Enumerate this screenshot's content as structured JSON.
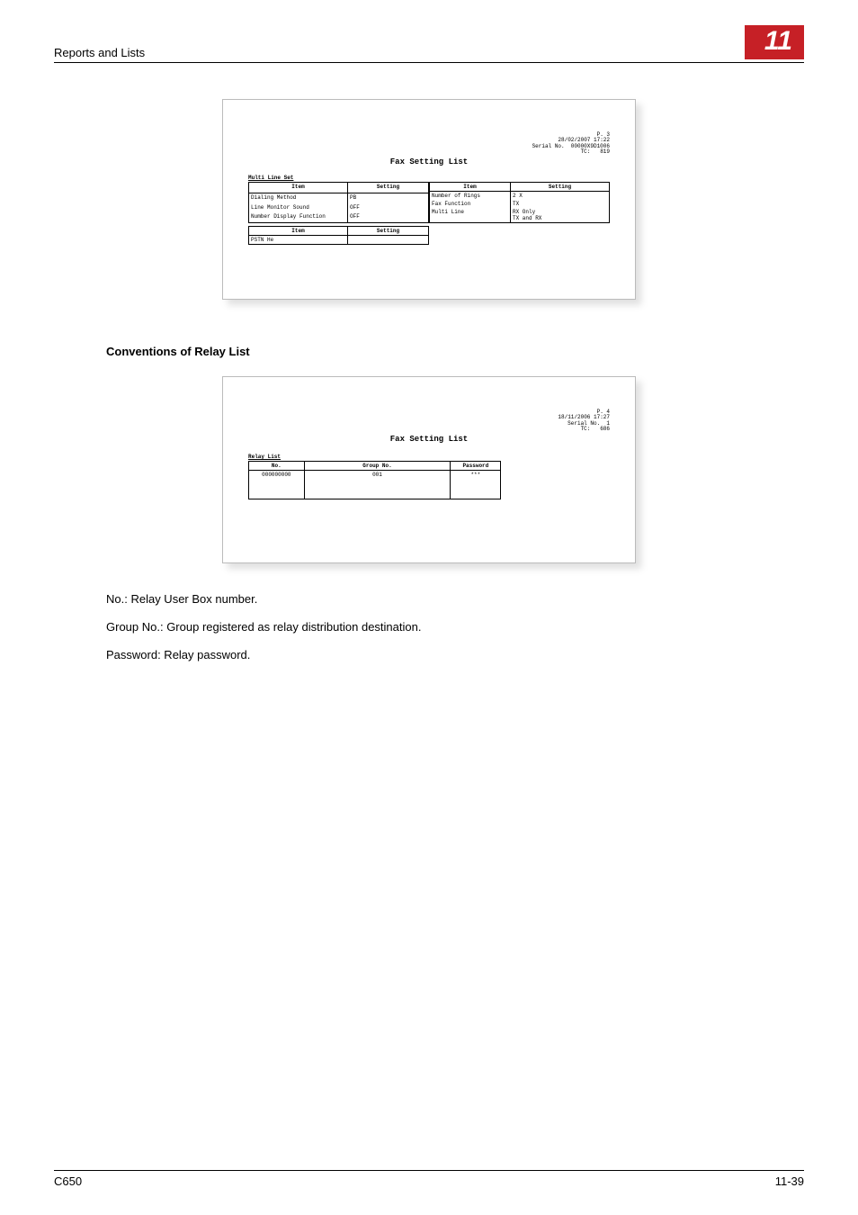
{
  "header": {
    "section_title": "Reports and Lists",
    "chapter_number": "11"
  },
  "figure1": {
    "title": "Fax Setting List",
    "meta_p": "P.  3",
    "meta_date": "28/02/2007 17:22",
    "meta_serial_label": "Serial No.",
    "meta_serial_value": "00000X9D1006",
    "meta_tc_label": "TC:",
    "meta_tc_value": "819",
    "section_label": "Multi Line Set",
    "th_item": "Item",
    "th_setting": "Setting",
    "left_rows": [
      {
        "item": "Dialing Method",
        "setting": "PB"
      },
      {
        "item": "Line Monitor Sound",
        "setting": "OFF"
      },
      {
        "item": "Number Display Function",
        "setting": "OFF"
      }
    ],
    "right_rows": [
      {
        "item": "Number of Rings",
        "setting": "2    X"
      },
      {
        "item": "Fax Function",
        "setting": "TX"
      },
      {
        "item": "Multi Line",
        "setting": "RX Only\nTX and RX"
      }
    ],
    "bottom_th_item": "Item",
    "bottom_th_setting": "Setting",
    "bottom_item": "PSTN He"
  },
  "heading2": "Conventions of Relay List",
  "figure2": {
    "title": "Fax Setting List",
    "meta_p": "P.  4",
    "meta_date": "18/11/2006 17:27",
    "meta_serial_label": "Serial No.",
    "meta_serial_value": "1",
    "meta_tc_label": "TC:",
    "meta_tc_value": "686",
    "section_label": "Relay List",
    "th_no": "No.",
    "th_group": "Group No.",
    "th_password": "Password",
    "row_no": "000000000",
    "row_group": "001",
    "row_password": "***"
  },
  "notes": {
    "line1": "No.: Relay User Box number.",
    "line2": "Group No.: Group registered as relay distribution destination.",
    "line3": "Password: Relay password."
  },
  "footer": {
    "left": "C650",
    "right": "11-39"
  }
}
